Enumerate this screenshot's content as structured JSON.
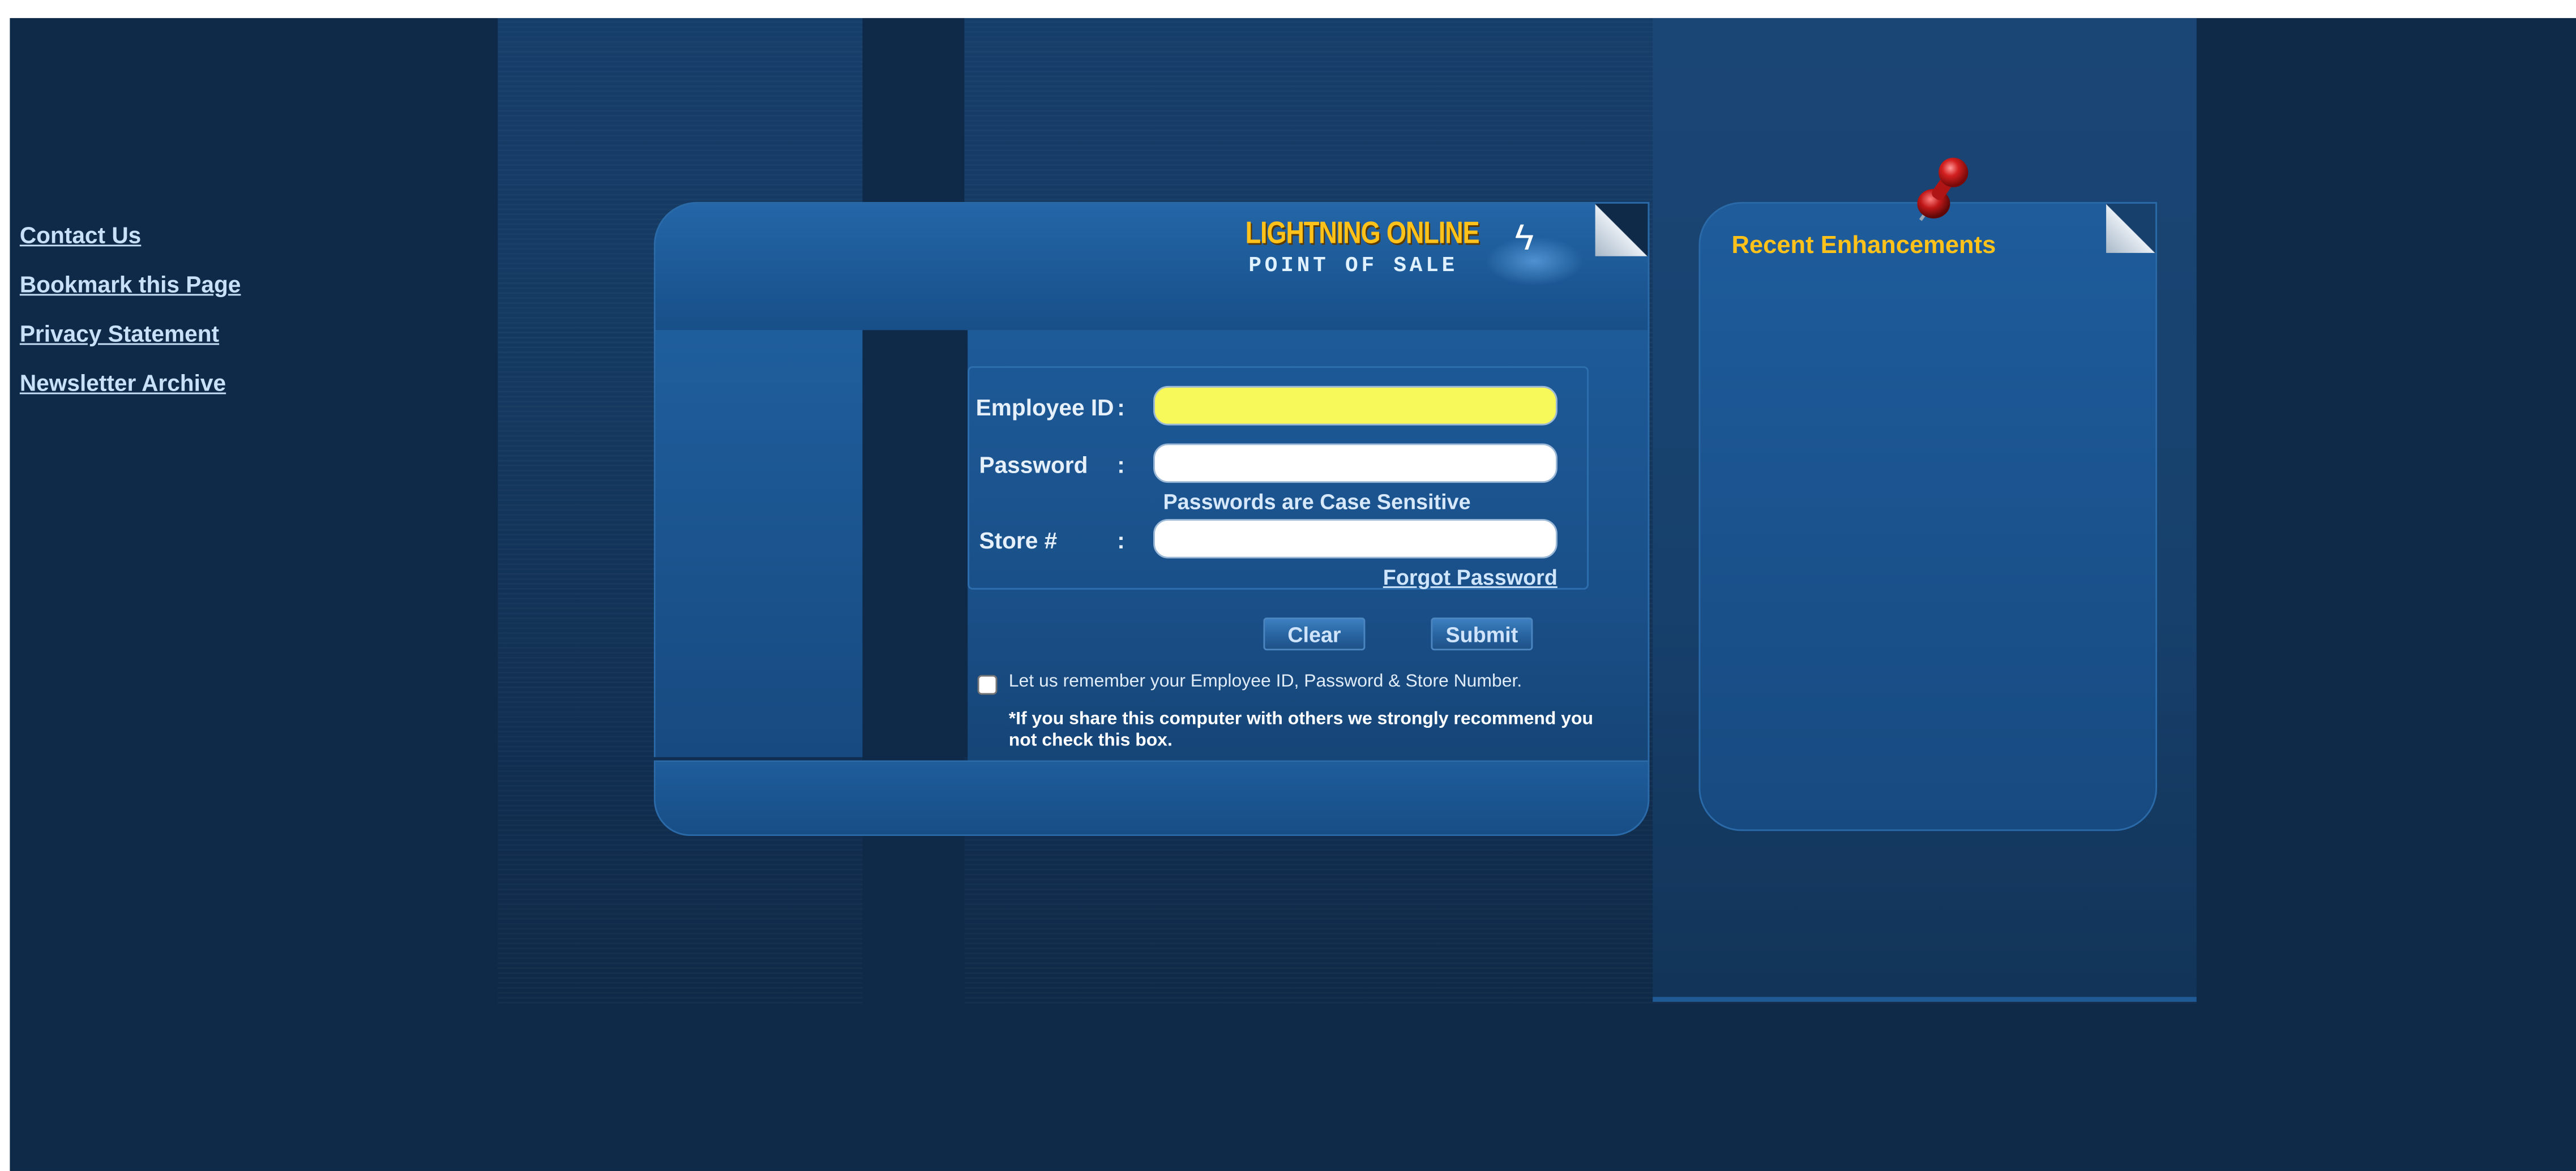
{
  "colors": {
    "page_bg": "#0f2a48",
    "panel_blue": "#1d5a98",
    "accent_yellow": "#ffc21a",
    "highlight_input": "#f7f859",
    "link": "#c8e0f8"
  },
  "left_nav": {
    "items": [
      {
        "label": "Contact Us"
      },
      {
        "label": "Bookmark this Page"
      },
      {
        "label": "Privacy Statement"
      },
      {
        "label": "Newsletter Archive"
      }
    ]
  },
  "logo": {
    "line1": "LIGHTNING ONLINE",
    "line2": "POINT OF SALE",
    "icon": "lightning-bolt-icon"
  },
  "login": {
    "employee_label": "Employee ID",
    "password_label": "Password",
    "store_label": "Store #",
    "colon": ":",
    "employee_value": "",
    "password_value": "",
    "store_value": "",
    "case_note": "Passwords are Case Sensitive",
    "forgot_label": "Forgot Password",
    "clear_label": "Clear",
    "submit_label": "Submit",
    "remember_text": "Let us remember your Employee ID, Password & Store Number.",
    "remember_checked": false,
    "warning_text": "*If you share this computer with others we strongly recommend you not check this box."
  },
  "enhancements": {
    "title": "Recent Enhancements",
    "icon": "pushpin-icon"
  }
}
